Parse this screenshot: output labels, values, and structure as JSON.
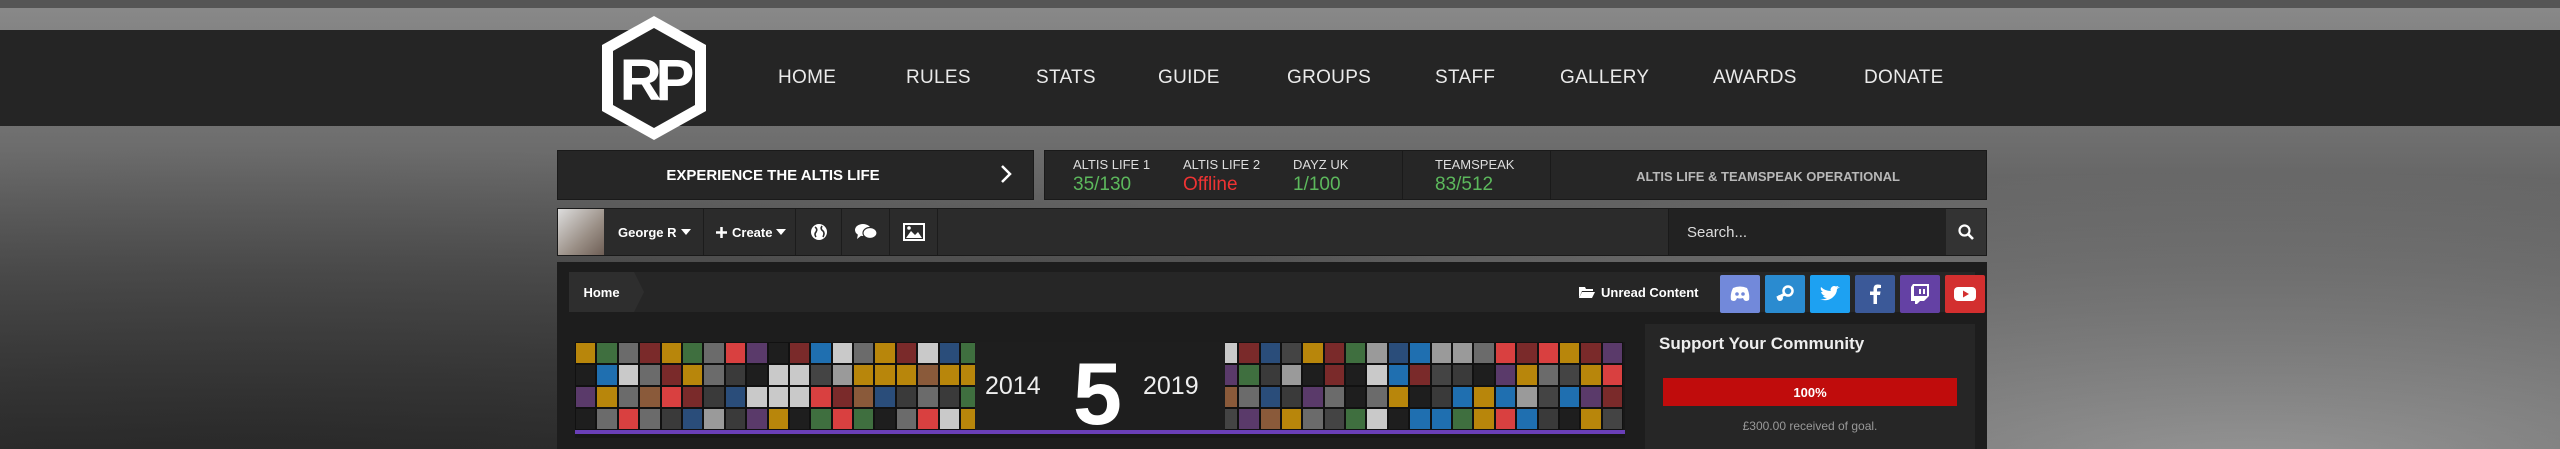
{
  "nav": [
    "HOME",
    "RULES",
    "STATS",
    "GUIDE",
    "GROUPS",
    "STAFF",
    "GALLERY",
    "AWARDS",
    "DONATE"
  ],
  "logo_text": "RP",
  "experience": {
    "label": "EXPERIENCE THE ALTIS LIFE"
  },
  "servers": [
    {
      "name": "ALTIS LIFE 1",
      "value": "35/130",
      "status": "online"
    },
    {
      "name": "ALTIS LIFE 2",
      "value": "Offline",
      "status": "offline"
    },
    {
      "name": "DAYZ UK",
      "value": "1/100",
      "status": "online"
    },
    {
      "name": "TEAMSPEAK",
      "value": "83/512",
      "status": "online"
    }
  ],
  "operational": "ALTIS LIFE & TEAMSPEAK OPERATIONAL",
  "userbar": {
    "username": "George R",
    "create_label": "Create"
  },
  "search": {
    "placeholder": "Search..."
  },
  "breadcrumb": {
    "home": "Home"
  },
  "unread_label": "Unread Content",
  "social": [
    {
      "name": "discord",
      "color": "#7289da"
    },
    {
      "name": "steam",
      "color": "#2a8bd0"
    },
    {
      "name": "twitter",
      "color": "#1da1f2"
    },
    {
      "name": "facebook",
      "color": "#3b5998"
    },
    {
      "name": "twitch",
      "color": "#6441a4"
    },
    {
      "name": "youtube",
      "color": "#d32f2f"
    }
  ],
  "banner": {
    "year_start": "2014",
    "number": "5",
    "year_end": "2019"
  },
  "support": {
    "title": "Support Your Community",
    "progress_label": "100%",
    "progress_percent": 100,
    "goal_text": "£300.00 received of goal."
  },
  "colors": {
    "online": "#5cb85c",
    "offline": "#e33",
    "progress": "#c00c0c",
    "banner_stripe": "#6a3fb8"
  }
}
